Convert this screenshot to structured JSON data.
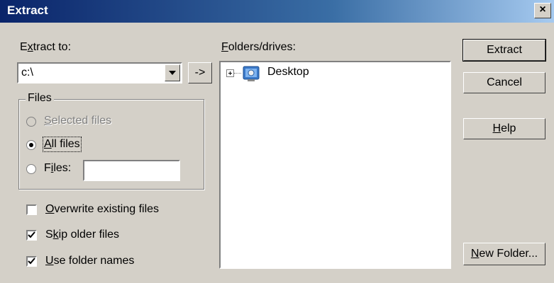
{
  "window": {
    "title": "Extract",
    "close_glyph": "×"
  },
  "extract_to": {
    "label_pre": "E",
    "label_mn": "x",
    "label_post": "tract to:",
    "value": "c:\\",
    "arrow_label": "->"
  },
  "files_group": {
    "legend": "Files",
    "options": [
      {
        "mn": "S",
        "rest": "elected files",
        "pre": "",
        "checked": false,
        "disabled": true
      },
      {
        "mn": "A",
        "rest": "ll files",
        "pre": "",
        "checked": true,
        "disabled": false
      },
      {
        "mn": "i",
        "rest": "les:",
        "pre": "F",
        "checked": false,
        "disabled": false
      }
    ],
    "files_value": ""
  },
  "checkboxes": [
    {
      "mn": "O",
      "rest": "verwrite existing files",
      "checked": false
    },
    {
      "mn": "k",
      "pre": "S",
      "rest": "ip older files",
      "checked": true
    },
    {
      "mn": "U",
      "rest": "se folder names",
      "checked": true
    }
  ],
  "folders": {
    "label_mn": "F",
    "label_post": "olders/drives:",
    "tree_item": "Desktop",
    "icon": "desktop-icon"
  },
  "buttons": {
    "extract": "Extract",
    "cancel": "Cancel",
    "help_mn": "H",
    "help_post": "elp",
    "new_folder_mn": "N",
    "new_folder_post": "ew Folder..."
  }
}
